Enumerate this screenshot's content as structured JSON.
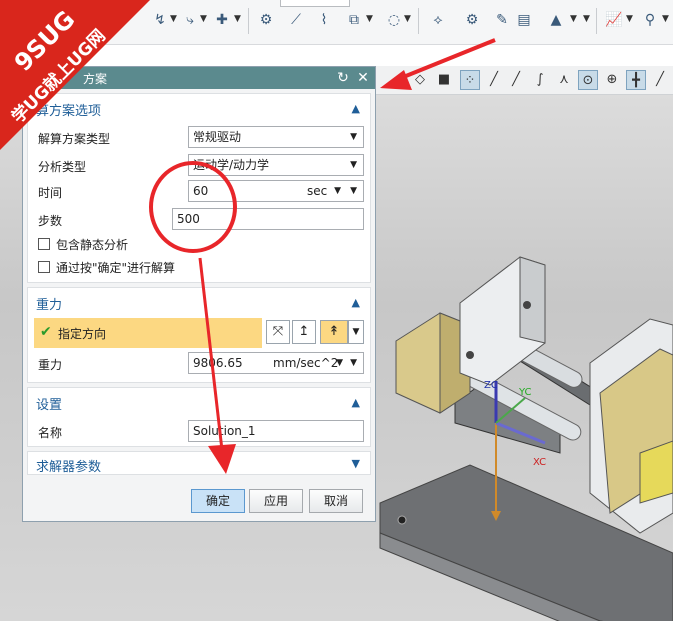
{
  "watermark": {
    "line1": "9SUG",
    "line2": "学UG就上UG网"
  },
  "dialog": {
    "title": "方案",
    "sections": {
      "solution": {
        "header": "算方案选项",
        "type_label": "解算方案类型",
        "type_value": "常规驱动",
        "analysis_label": "分析类型",
        "analysis_value": "运动学/动力学",
        "time_label": "时间",
        "time_value": "60",
        "time_unit": "sec",
        "steps_label": "步数",
        "steps_value": "500",
        "static_label": "包含静态分析",
        "confirm_label": "通过按\"确定\"进行解算"
      },
      "gravity": {
        "header": "重力",
        "direction_label": "指定方向",
        "gravity_label": "重力",
        "gravity_value": "9806.65",
        "gravity_unit": "mm/sec^2"
      },
      "settings": {
        "header": "设置",
        "name_label": "名称",
        "name_value": "Solution_1"
      },
      "solver": {
        "header": "求解器参数"
      }
    },
    "buttons": {
      "ok": "确定",
      "apply": "应用",
      "cancel": "取消"
    }
  },
  "colors": {
    "title_bar": "#5b8a8e",
    "section_header": "#1f5e98",
    "highlight": "#fcd882",
    "annotation": "#e8262a"
  }
}
